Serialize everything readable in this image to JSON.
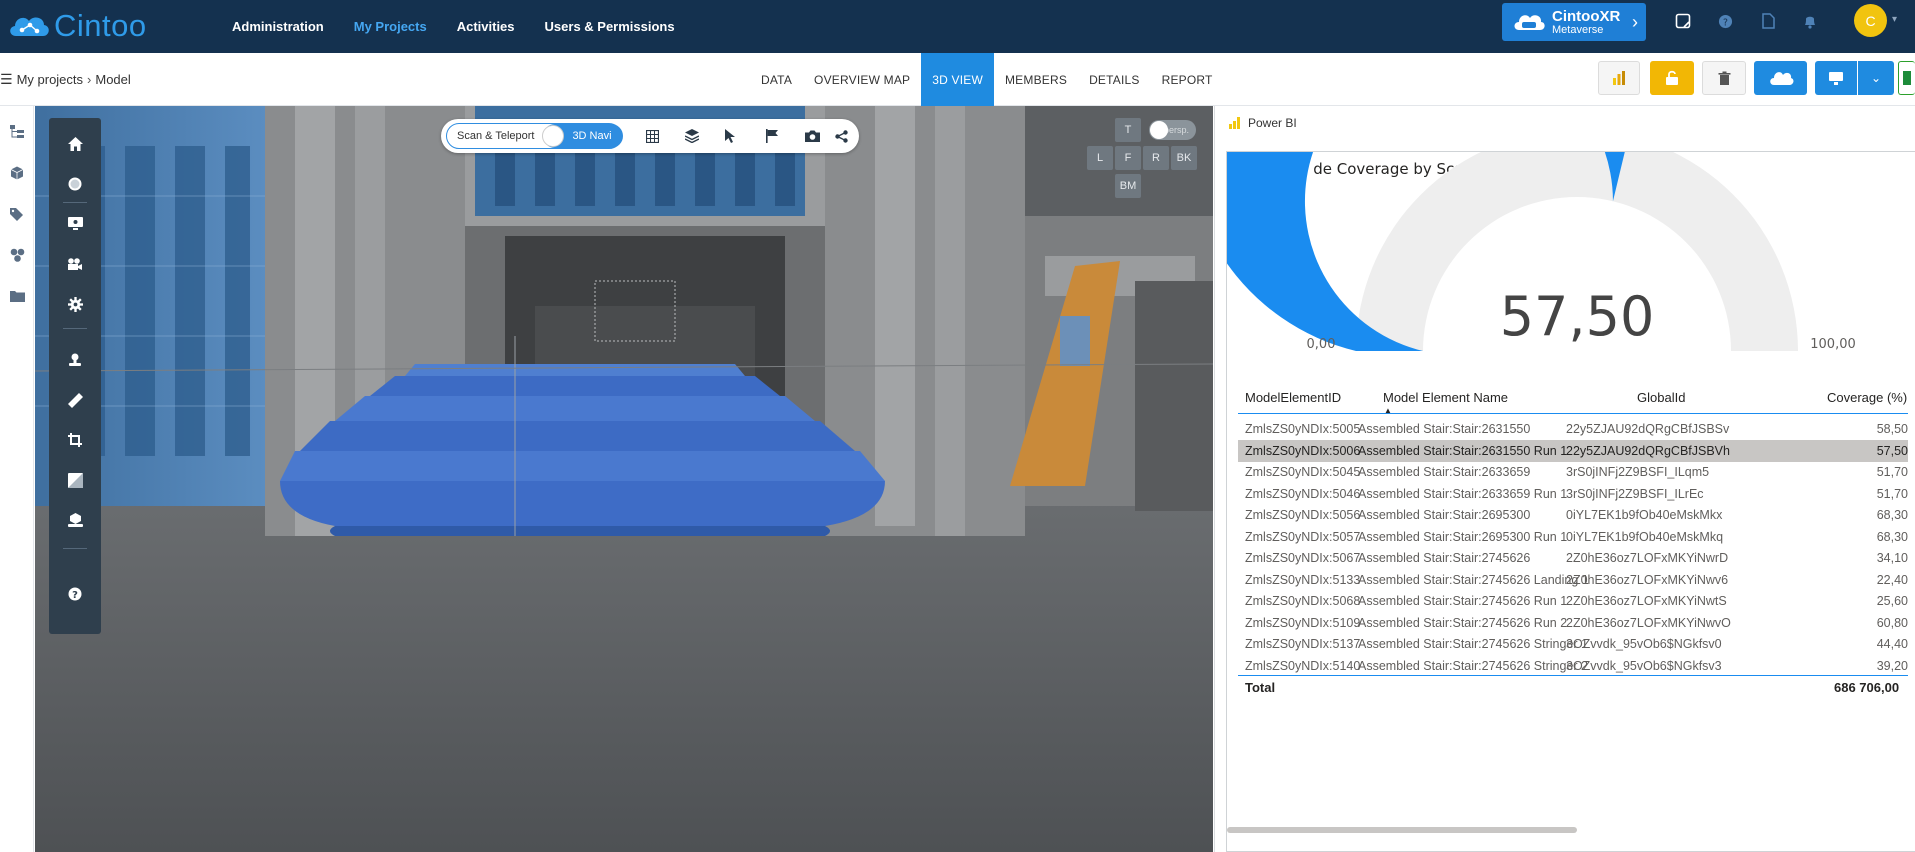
{
  "app": {
    "brand": "Cintoo",
    "nav": [
      "Administration",
      "My Projects",
      "Activities",
      "Users & Permissions"
    ],
    "active_nav": "My Projects",
    "xr_button": {
      "title": "CintooXR",
      "subtitle": "Metaverse"
    },
    "avatar_initial": "C",
    "colors": {
      "navbar": "#14314f",
      "accent": "#1f8be0",
      "active_nav": "#45a7f2"
    }
  },
  "breadcrumb": {
    "root": "My projects",
    "current": "Model"
  },
  "tabs": [
    "DATA",
    "OVERVIEW MAP",
    "3D VIEW",
    "MEMBERS",
    "DETAILS",
    "REPORT"
  ],
  "active_tab": "3D VIEW",
  "viewer": {
    "mode_left": "Scan & Teleport",
    "mode_right": "3D Navi",
    "viewcube": {
      "top": "T",
      "left": "L",
      "front": "F",
      "right": "R",
      "back": "BK",
      "bottom": "BM"
    },
    "persp_label": "persp."
  },
  "powerbi": {
    "panel_title": "Power BI",
    "gauge": {
      "title": "Moyenne de Coverage by Scan Data (%)",
      "value": 57.5,
      "value_label": "57,50",
      "min_label": "0,00",
      "max_label": "100,00"
    },
    "table": {
      "columns": [
        "ModelElementID",
        "Model Element Name",
        "GlobalId",
        "Coverage (%)"
      ],
      "rows": [
        [
          "ZmlsZS0yNDIx:5005",
          "Assembled Stair:Stair:2631550",
          "22y5ZJAU92dQRgCBfJSBSv",
          "58,50"
        ],
        [
          "ZmlsZS0yNDIx:5006",
          "Assembled Stair:Stair:2631550 Run 1",
          "22y5ZJAU92dQRgCBfJSBVh",
          "57,50"
        ],
        [
          "ZmlsZS0yNDIx:5045",
          "Assembled Stair:Stair:2633659",
          "3rS0jINFj2Z9BSFI_ILqm5",
          "51,70"
        ],
        [
          "ZmlsZS0yNDIx:5046",
          "Assembled Stair:Stair:2633659 Run 1",
          "3rS0jINFj2Z9BSFI_ILrEc",
          "51,70"
        ],
        [
          "ZmlsZS0yNDIx:5056",
          "Assembled Stair:Stair:2695300",
          "0iYL7EK1b9fOb40eMskMkx",
          "68,30"
        ],
        [
          "ZmlsZS0yNDIx:5057",
          "Assembled Stair:Stair:2695300 Run 1",
          "0iYL7EK1b9fOb40eMskMkq",
          "68,30"
        ],
        [
          "ZmlsZS0yNDIx:5067",
          "Assembled Stair:Stair:2745626",
          "2Z0hE36oz7LOFxMKYiNwrD",
          "34,10"
        ],
        [
          "ZmlsZS0yNDIx:5133",
          "Assembled Stair:Stair:2745626 Landing 1",
          "2Z0hE36oz7LOFxMKYiNwv6",
          "22,40"
        ],
        [
          "ZmlsZS0yNDIx:5068",
          "Assembled Stair:Stair:2745626 Run 1",
          "2Z0hE36oz7LOFxMKYiNwtS",
          "25,60"
        ],
        [
          "ZmlsZS0yNDIx:5109",
          "Assembled Stair:Stair:2745626 Run 2",
          "2Z0hE36oz7LOFxMKYiNwvO",
          "60,80"
        ],
        [
          "ZmlsZS0yNDIx:5137",
          "Assembled Stair:Stair:2745626 Stringer 1",
          "3OZvvdk_95vOb6$NGkfsv0",
          "44,40"
        ],
        [
          "ZmlsZS0yNDIx:5140",
          "Assembled Stair:Stair:2745626 Stringer 2",
          "3OZvvdk_95vOb6$NGkfsv3",
          "39,20"
        ]
      ],
      "selected_row": 1,
      "total_label": "Total",
      "total_value": "686 706,00"
    }
  }
}
